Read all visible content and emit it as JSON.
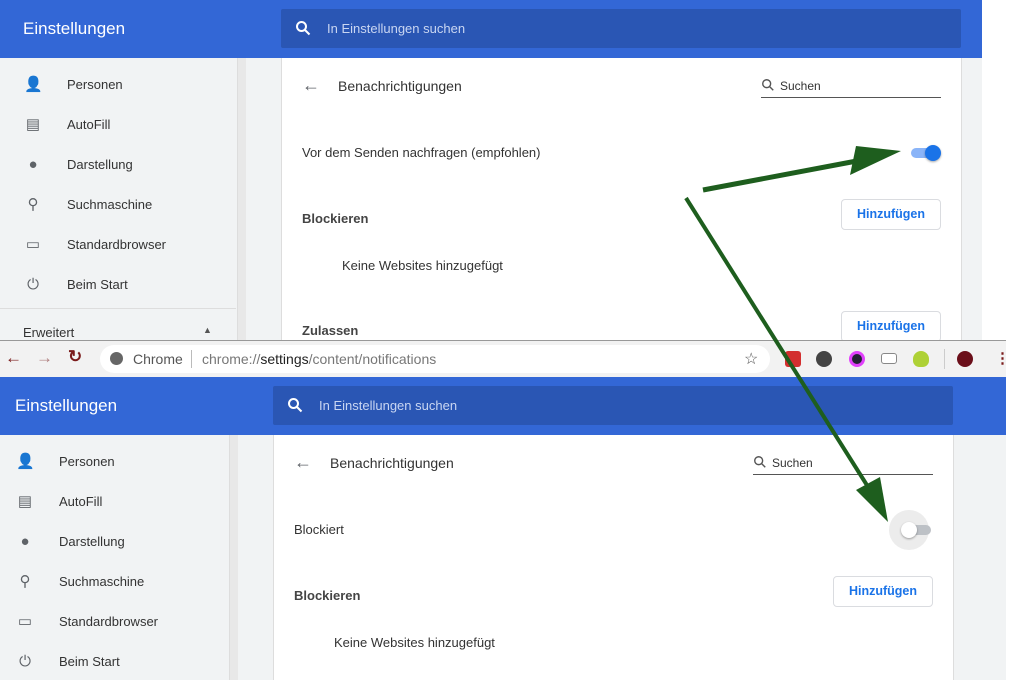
{
  "top": {
    "header_title": "Einstellungen",
    "search_placeholder": "In Einstellungen suchen",
    "sidebar": [
      {
        "label": "Personen",
        "icon": "person-icon"
      },
      {
        "label": "AutoFill",
        "icon": "clipboard-icon"
      },
      {
        "label": "Darstellung",
        "icon": "palette-icon"
      },
      {
        "label": "Suchmaschine",
        "icon": "search-icon"
      },
      {
        "label": "Standardbrowser",
        "icon": "browser-icon"
      },
      {
        "label": "Beim Start",
        "icon": "power-icon"
      }
    ],
    "advanced": "Erweitert",
    "content_title": "Benachrichtigungen",
    "content_search": "Suchen",
    "toggle_label": "Vor dem Senden nachfragen (empfohlen)",
    "toggle_on": true,
    "block_heading": "Blockieren",
    "add_button": "Hinzufügen",
    "empty_text": "Keine Websites hinzugefügt",
    "allow_heading": "Zulassen",
    "allow_add_button": "Hinzufügen"
  },
  "browser": {
    "site_label": "Chrome",
    "url_prefix": "chrome://",
    "url_host": "settings",
    "url_path": "/content/notifications"
  },
  "bottom": {
    "header_title": "Einstellungen",
    "search_placeholder": "In Einstellungen suchen",
    "sidebar": [
      {
        "label": "Personen"
      },
      {
        "label": "AutoFill"
      },
      {
        "label": "Darstellung"
      },
      {
        "label": "Suchmaschine"
      },
      {
        "label": "Standardbrowser"
      },
      {
        "label": "Beim Start"
      }
    ],
    "content_title": "Benachrichtigungen",
    "content_search": "Suchen",
    "toggle_label": "Blockiert",
    "toggle_on": false,
    "block_heading": "Blockieren",
    "add_button": "Hinzufügen",
    "empty_text": "Keine Websites hinzugefügt"
  },
  "colors": {
    "header": "#3367d6",
    "accent": "#1a73e8",
    "arrow": "#1e5e1e"
  }
}
